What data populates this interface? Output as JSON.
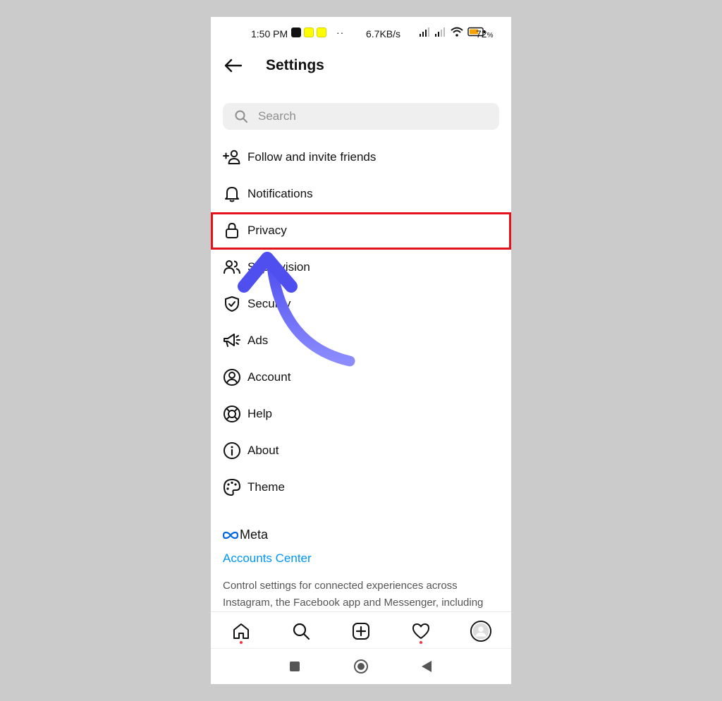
{
  "status_bar": {
    "time": "1:50 PM",
    "dots": "··",
    "net_speed": "6.7KB/s",
    "battery_percent": "72",
    "battery_suffix": "%",
    "battery_level": 0.72,
    "app_icons": [
      "tiktok-icon",
      "snapchat-icon",
      "snapchat-icon"
    ]
  },
  "header": {
    "title": "Settings",
    "back_icon": "arrow-left-icon"
  },
  "search": {
    "placeholder": "Search"
  },
  "menu": {
    "items": [
      {
        "label": "Follow and invite friends",
        "icon": "add-person-icon"
      },
      {
        "label": "Notifications",
        "icon": "bell-icon"
      },
      {
        "label": "Privacy",
        "icon": "lock-icon"
      },
      {
        "label": "Supervision",
        "icon": "people-icon"
      },
      {
        "label": "Security",
        "icon": "shield-check-icon"
      },
      {
        "label": "Ads",
        "icon": "megaphone-icon"
      },
      {
        "label": "Account",
        "icon": "account-circle-icon"
      },
      {
        "label": "Help",
        "icon": "lifebuoy-icon"
      },
      {
        "label": "About",
        "icon": "info-icon"
      },
      {
        "label": "Theme",
        "icon": "palette-icon"
      }
    ],
    "highlighted": "Privacy"
  },
  "meta": {
    "logo_text": "Meta",
    "accounts_center": "Accounts Center",
    "description": "Control settings for connected experiences across Instagram, the Facebook app and Messenger, including"
  },
  "bottom_nav": [
    "home-icon",
    "search-icon",
    "new-post-icon",
    "heart-icon",
    "profile-avatar"
  ],
  "colors": {
    "highlight": "#e3121b",
    "link": "#0095f6",
    "arrow": "#5b5bf5",
    "notification_dot": "#ff3040"
  }
}
